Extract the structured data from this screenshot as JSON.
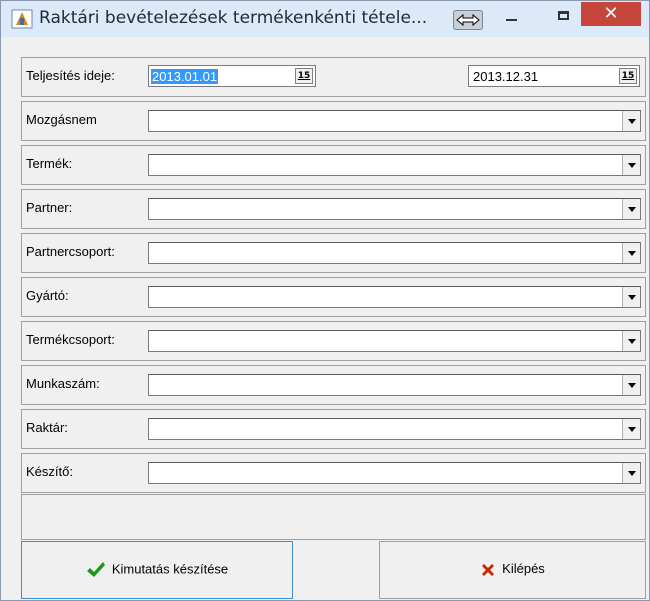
{
  "window": {
    "title": "Raktári bevételezések termékenkénti tétele...",
    "close_glyph": "✕"
  },
  "fields": [
    {
      "label": "Teljesítés ideje:",
      "type": "daterange"
    },
    {
      "label": "Mozgásnem",
      "value": ""
    },
    {
      "label": "Termék:",
      "value": ""
    },
    {
      "label": "Partner:",
      "value": ""
    },
    {
      "label": "Partnercsoport:",
      "value": ""
    },
    {
      "label": "Gyártó:",
      "value": ""
    },
    {
      "label": "Termékcsoport:",
      "value": ""
    },
    {
      "label": "Munkaszám:",
      "value": ""
    },
    {
      "label": "Raktár:",
      "value": ""
    },
    {
      "label": "Készítő:",
      "value": ""
    }
  ],
  "date_from": "2013.01.01",
  "date_to": "2013.12.31",
  "calendar_icon_text": "15",
  "buttons": {
    "generate": {
      "label": "Kimutatás készítése",
      "icon": "checkmark-icon",
      "icon_color": "#1a9a1a"
    },
    "exit": {
      "label": "Kilépés",
      "icon": "x-icon",
      "icon_color": "#cc2200"
    }
  }
}
